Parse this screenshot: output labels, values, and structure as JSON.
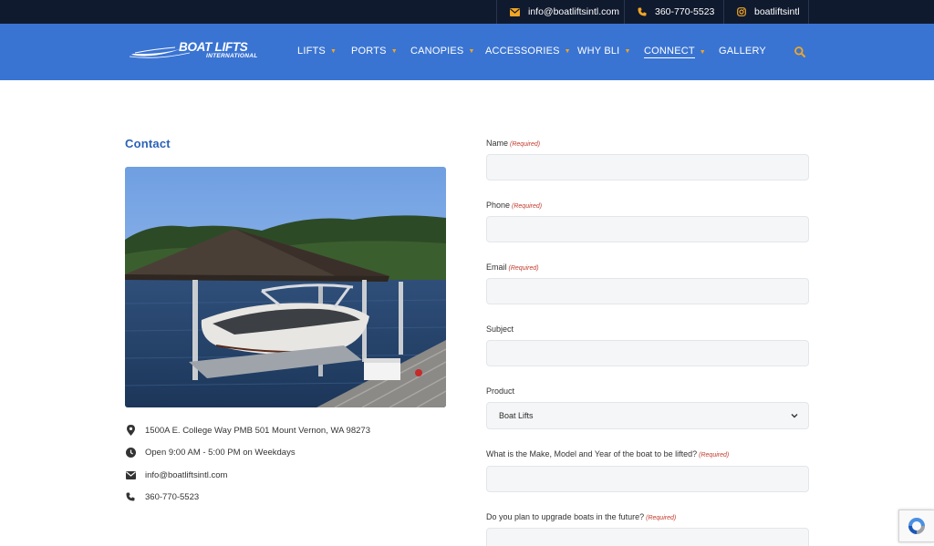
{
  "topbar": {
    "email": "info@boatliftsintl.com",
    "phone": "360-770-5523",
    "instagram": "boatliftsintl"
  },
  "logo": {
    "brand": "BOAT LIFTS",
    "sub": "INTERNATIONAL"
  },
  "nav": [
    {
      "label": "LIFTS",
      "dropdown": true
    },
    {
      "label": "PORTS",
      "dropdown": true
    },
    {
      "label": "CANOPIES",
      "dropdown": true
    },
    {
      "label": "ACCESSORIES",
      "dropdown": true
    },
    {
      "label": "WHY BLI",
      "dropdown": true
    },
    {
      "label": "CONNECT",
      "dropdown": true,
      "active": true
    },
    {
      "label": "GALLERY",
      "dropdown": false
    }
  ],
  "contact": {
    "title": "Contact",
    "address": "1500A E. College Way PMB 501 Mount Vernon, WA 98273",
    "hours": "Open 9:00 AM - 5:00 PM on Weekdays",
    "email": "info@boatliftsintl.com",
    "phone": "360-770-5523"
  },
  "form": {
    "required_text": "(Required)",
    "name_label": "Name",
    "phone_label": "Phone",
    "email_label": "Email",
    "subject_label": "Subject",
    "product_label": "Product",
    "product_value": "Boat Lifts",
    "boat_label": "What is the Make, Model and Year of the boat to be lifted?",
    "upgrade_label": "Do you plan to upgrade boats in the future?"
  },
  "colors": {
    "topbar": "#101a2e",
    "navbar": "#3a74d2",
    "accent": "#f2a623",
    "title": "#2a62b8",
    "required": "#c0392b"
  }
}
